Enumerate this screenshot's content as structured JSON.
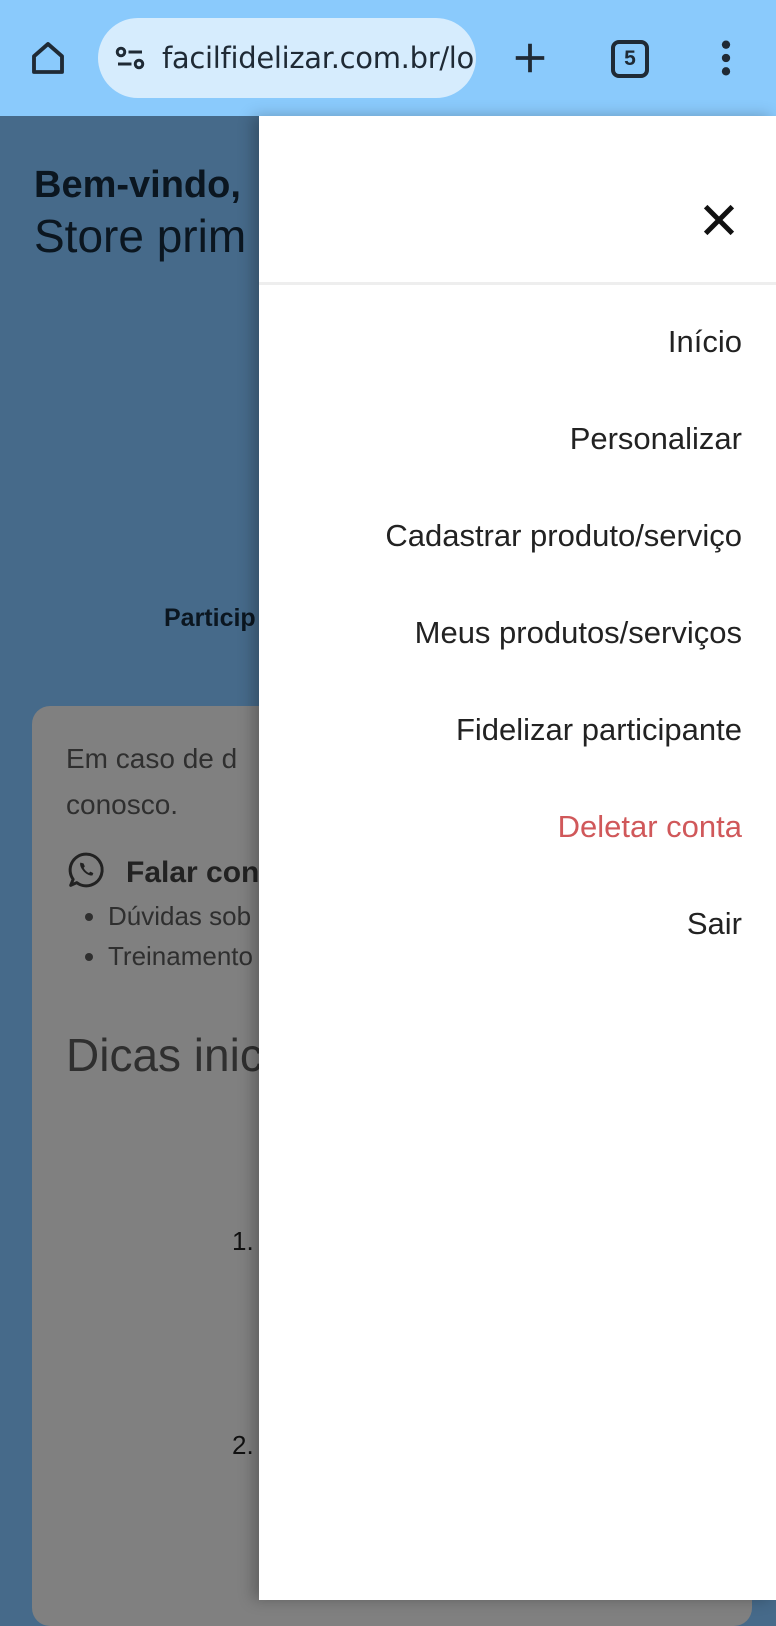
{
  "browser": {
    "url": "facilfidelizar.com.br/loj",
    "tab_count": "5",
    "icons": [
      "home-icon",
      "site-settings-icon",
      "new-tab-icon",
      "tab-switcher-icon",
      "more-menu-icon"
    ]
  },
  "page": {
    "welcome": "Bem-vindo,",
    "store_name": "Store prim",
    "participants_label": "Particip",
    "help_line1": "Em caso de d",
    "help_line2": "conosco.",
    "whatsapp_label": "Falar con",
    "bullets": [
      "Dúvidas sob",
      "Treinamento"
    ],
    "tips_title": "Dicas inic",
    "step1": "1.",
    "step2": "2."
  },
  "drawer": {
    "menu": [
      {
        "label": "Início",
        "color": "#222222"
      },
      {
        "label": "Personalizar",
        "color": "#222222"
      },
      {
        "label": "Cadastrar produto/serviço",
        "color": "#222222"
      },
      {
        "label": "Meus produtos/serviços",
        "color": "#222222"
      },
      {
        "label": "Fidelizar participante",
        "color": "#222222"
      },
      {
        "label": "Deletar conta",
        "color": "#d0585a"
      },
      {
        "label": "Sair",
        "color": "#222222"
      }
    ]
  },
  "colors": {
    "toolbar": "#8acafc",
    "overlay_page": "#466a8a",
    "danger": "#d0585a"
  }
}
